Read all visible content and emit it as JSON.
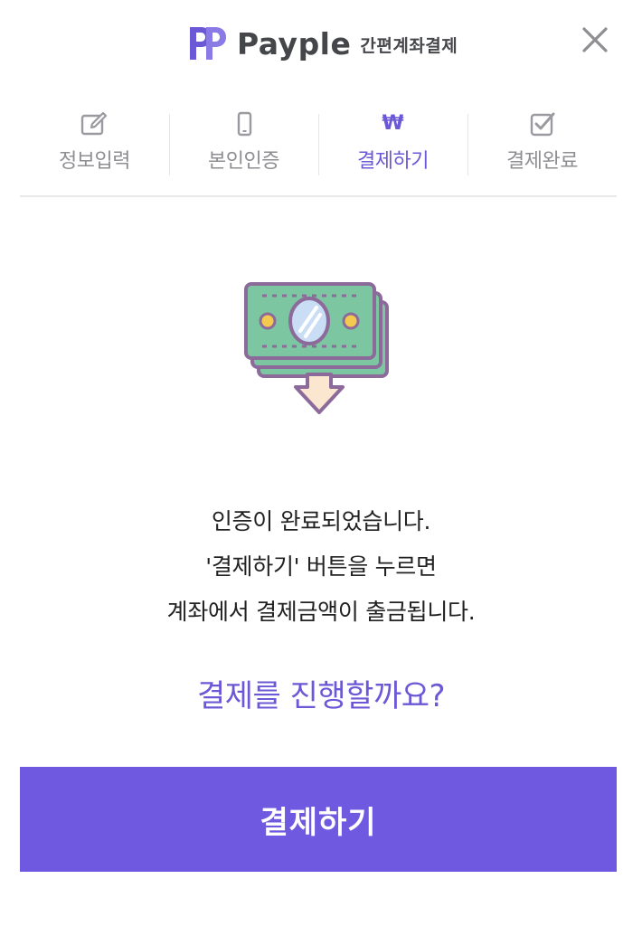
{
  "brand": {
    "name": "Payple",
    "subtitle": "간편계좌결제",
    "accent_color": "#6f59e0",
    "logo_color": "#6b58d6"
  },
  "header": {
    "close_icon": "close-icon"
  },
  "steps": [
    {
      "label": "정보입력",
      "icon": "edit-icon",
      "active": false
    },
    {
      "label": "본인인증",
      "icon": "mobile-phone-icon",
      "active": false
    },
    {
      "label": "결제하기",
      "icon": "won-icon",
      "icon_text": "₩",
      "active": true
    },
    {
      "label": "결제완료",
      "icon": "checkbox-icon",
      "active": false
    }
  ],
  "illustration": {
    "icon": "money-withdraw-icon"
  },
  "message": {
    "line1": "인증이 완료되었습니다.",
    "line2": "'결제하기' 버튼을 누르면",
    "line3": "계좌에서 결제금액이 출금됩니다."
  },
  "question": "결제를 진행할까요?",
  "pay_button": {
    "label": "결제하기"
  }
}
